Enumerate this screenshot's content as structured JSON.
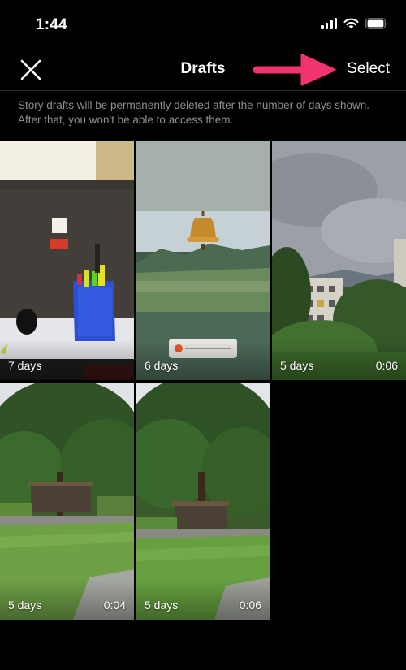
{
  "status_bar": {
    "time": "1:44"
  },
  "nav": {
    "title": "Drafts",
    "select_label": "Select"
  },
  "notice": "Story drafts will be permanently deleted after the number of days shown. After that, you won't be able to access them.",
  "drafts": [
    {
      "days": "7 days",
      "duration": ""
    },
    {
      "days": "6 days",
      "duration": ""
    },
    {
      "days": "5 days",
      "duration": "0:06"
    },
    {
      "days": "5 days",
      "duration": "0:04"
    },
    {
      "days": "5 days",
      "duration": "0:06"
    }
  ],
  "colors": {
    "background": "#000000",
    "accent_arrow": "#f0346d",
    "muted_text": "#8e8e8e"
  },
  "icons": {
    "close": "close-icon",
    "arrow": "arrow-right-icon",
    "signal": "signal-icon",
    "wifi": "wifi-icon",
    "battery": "battery-icon"
  }
}
